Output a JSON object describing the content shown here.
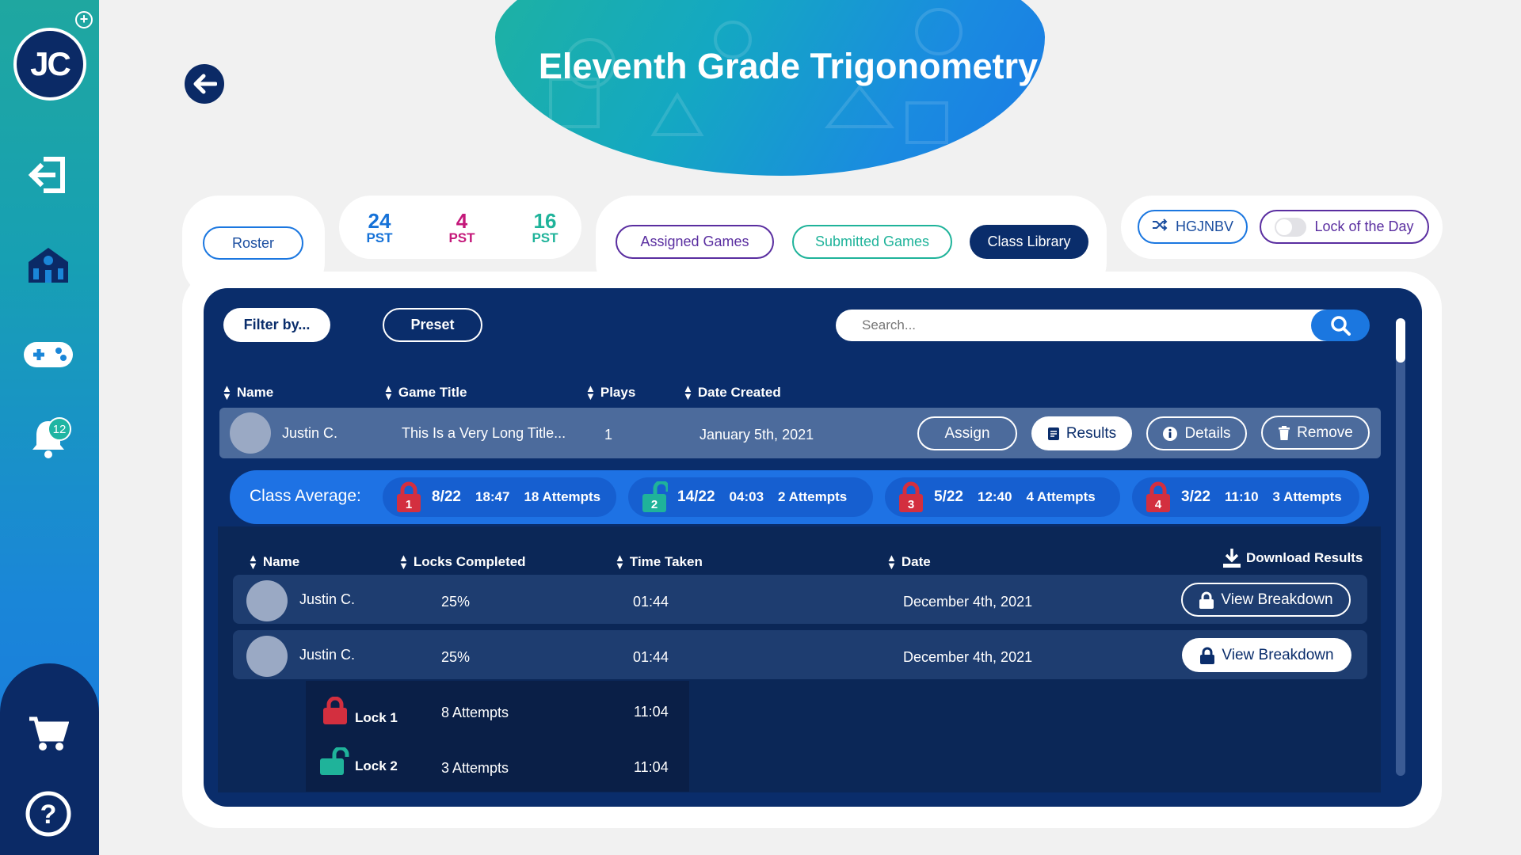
{
  "sidebar": {
    "avatar_initials": "JC",
    "notification_count": "12",
    "icons": [
      "add-icon",
      "logout-icon",
      "school-icon",
      "gamepad-icon",
      "bell-icon",
      "cart-icon",
      "help-icon"
    ]
  },
  "header": {
    "title": "Eleventh Grade Trigonometry"
  },
  "tabs": {
    "roster": "Roster",
    "stats": [
      {
        "num": "24",
        "label": "PST",
        "color": "#1672d8"
      },
      {
        "num": "4",
        "label": "PST",
        "color": "#c4187a"
      },
      {
        "num": "16",
        "label": "PST",
        "color": "#1fb39a"
      }
    ],
    "assigned_games": "Assigned Games",
    "submitted_games": "Submitted Games",
    "class_library": "Class Library",
    "class_code": "HGJNBV",
    "lock_of_day": "Lock of the Day"
  },
  "filters": {
    "filter_by": "Filter by...",
    "preset": "Preset",
    "search_placeholder": "Search..."
  },
  "library_table": {
    "headers": [
      "Name",
      "Game Title",
      "Plays",
      "Date Created"
    ],
    "row": {
      "name": "Justin C.",
      "game_title": "This Is a Very Long Title...",
      "plays": "1",
      "date_created": "January 5th, 2021",
      "assign": "Assign",
      "results": "Results",
      "details": "Details",
      "remove": "Remove"
    }
  },
  "class_average": {
    "label": "Class Average:",
    "locks": [
      {
        "num": "1",
        "frac": "8/22",
        "time": "18:47",
        "attempts": "18 Attempts",
        "state": "locked",
        "color": "#d32f3f"
      },
      {
        "num": "2",
        "frac": "14/22",
        "time": "04:03",
        "attempts": "2 Attempts",
        "state": "unlocked",
        "color": "#1fb39a"
      },
      {
        "num": "3",
        "frac": "5/22",
        "time": "12:40",
        "attempts": "4 Attempts",
        "state": "locked",
        "color": "#d32f3f"
      },
      {
        "num": "4",
        "frac": "3/22",
        "time": "11:10",
        "attempts": "3 Attempts",
        "state": "locked",
        "color": "#d32f3f"
      }
    ]
  },
  "results_table": {
    "headers": [
      "Name",
      "Locks Completed",
      "Time Taken",
      "Date"
    ],
    "download": "Download Results",
    "rows": [
      {
        "name": "Justin C.",
        "locks": "25%",
        "time": "01:44",
        "date": "December 4th, 2021",
        "action": "View Breakdown"
      },
      {
        "name": "Justin C.",
        "locks": "25%",
        "time": "01:44",
        "date": "December 4th, 2021",
        "action": "View Breakdown"
      }
    ],
    "breakdown": [
      {
        "lock": "Lock 1",
        "attempts": "8 Attempts",
        "time": "11:04",
        "state": "locked"
      },
      {
        "lock": "Lock 2",
        "attempts": "3 Attempts",
        "time": "11:04",
        "state": "unlocked"
      }
    ]
  }
}
